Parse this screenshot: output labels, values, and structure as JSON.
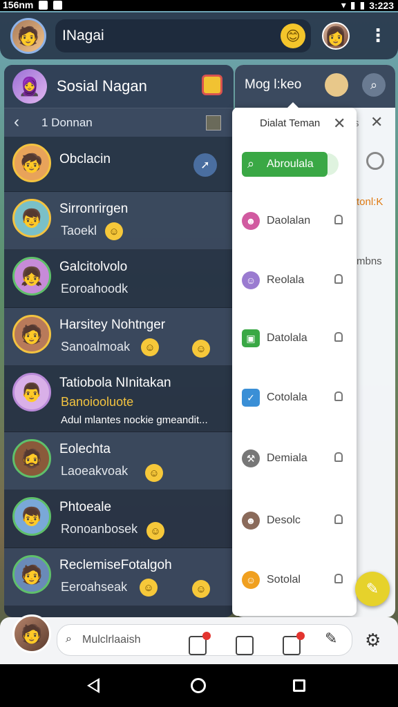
{
  "status_bar": {
    "left_text": "156nm",
    "time": "3:223"
  },
  "top_bar": {
    "title": "INagai",
    "emoji": "😊"
  },
  "left_panel": {
    "title": "Sosial Nagan",
    "sub_label": "1 Donnan",
    "conversations": [
      {
        "name": "Obclacin",
        "preview": "",
        "extra": ""
      },
      {
        "name": "Sirronrirgen",
        "preview": "Taoekl",
        "extra": ""
      },
      {
        "name": "Galcitolvolo",
        "preview": "Eoroahoodk",
        "extra": ""
      },
      {
        "name": "Harsitey Nohtnger",
        "preview": "Sanoalmoak",
        "extra": ""
      },
      {
        "name": "Tatiobola NInitakan",
        "preview": "Banoiooluote",
        "extra": "Adul mlantes nockie gmeandit..."
      },
      {
        "name": "Eolechta",
        "preview": "Laoeakvoak",
        "extra": ""
      },
      {
        "name": "Phtoeale",
        "preview": "Ronoanbosek",
        "extra": ""
      },
      {
        "name": "ReclemiseFotalgoh",
        "preview": "Eeroahseak",
        "extra": ""
      }
    ]
  },
  "right_panel": {
    "title": "Mog l:keo",
    "side_s": "s",
    "side_text1": "tonl:K",
    "side_text2": "mbns"
  },
  "menu": {
    "heading": "Dialat Teman",
    "action_label": "Abroulala",
    "items": [
      {
        "label": "Daolalan",
        "icon": "person-icon",
        "color": "#d15aa0"
      },
      {
        "label": "Reolala",
        "icon": "ghost-icon",
        "color": "#9a7bd0"
      },
      {
        "label": "Datolala",
        "icon": "image-icon",
        "color": "#3aa845"
      },
      {
        "label": "Cotolala",
        "icon": "chart-icon",
        "color": "#3a8fd6"
      },
      {
        "label": "Demiala",
        "icon": "wrench-icon",
        "color": "#777777"
      },
      {
        "label": "Desolc",
        "icon": "avatar-icon",
        "color": "#8a6a5a"
      },
      {
        "label": "Sotolal",
        "icon": "smile-icon",
        "color": "#f0a020"
      }
    ]
  },
  "bottom_bar": {
    "search_value": "Mulclrlaaish"
  }
}
